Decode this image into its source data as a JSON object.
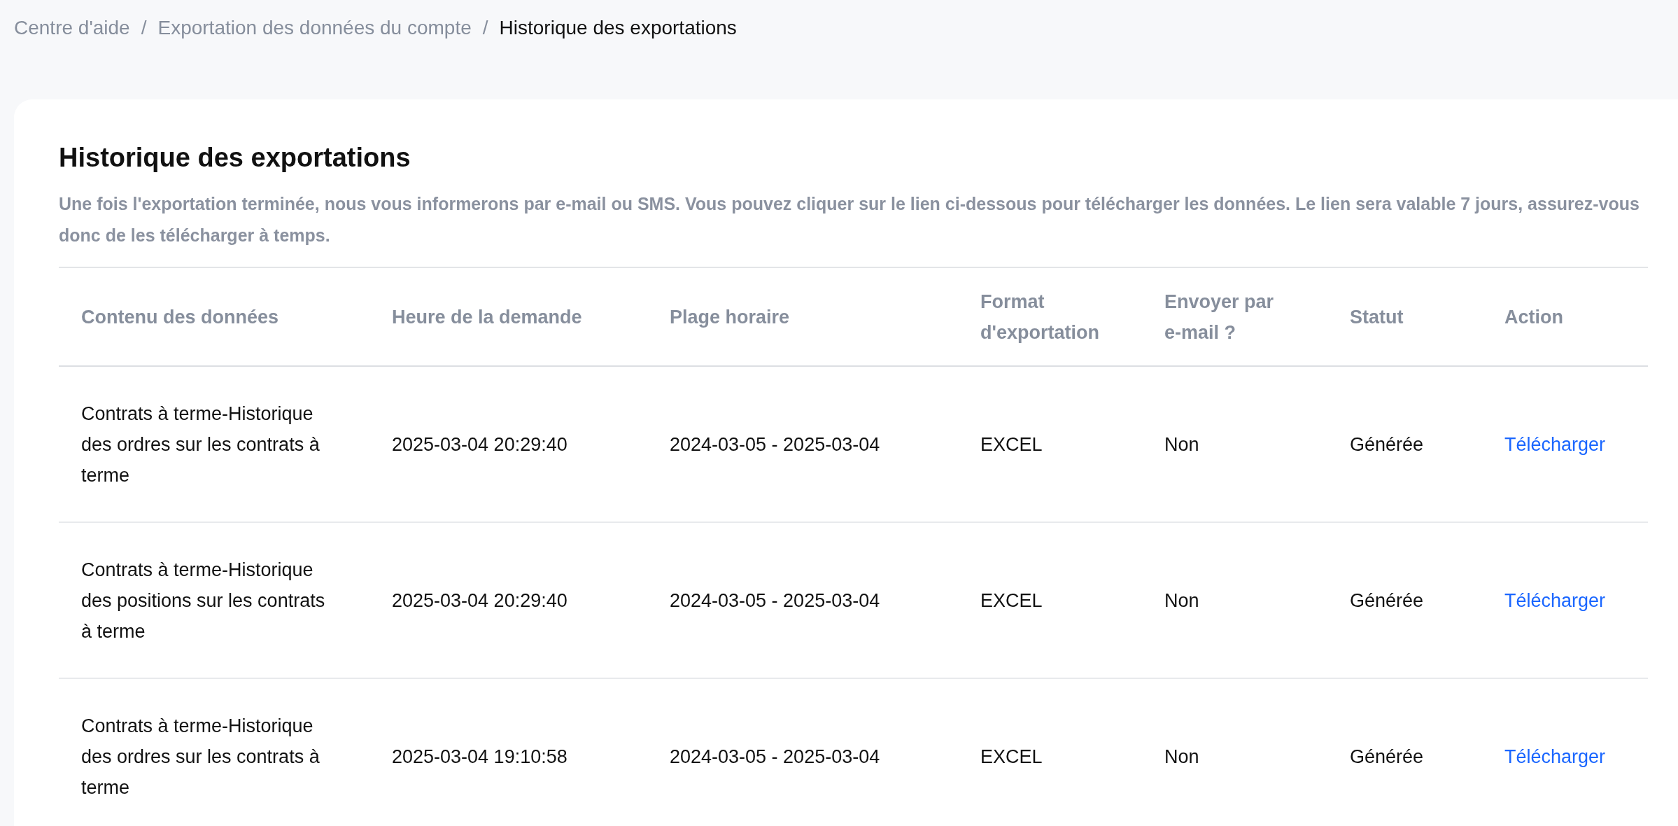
{
  "breadcrumb": [
    {
      "label": "Centre d'aide",
      "current": false
    },
    {
      "label": "Exportation des données du compte",
      "current": false
    },
    {
      "label": "Historique des exportations",
      "current": true
    }
  ],
  "separator": "/",
  "title": "Historique des exportations",
  "description": "Une fois l'exportation terminée, nous vous informerons par e-mail ou SMS. Vous pouvez cliquer sur le lien ci-dessous pour télécharger les données. Le lien sera valable 7 jours, assurez-vous donc de les télécharger à temps.",
  "table": {
    "columns": [
      "Contenu des données",
      "Heure de la demande",
      "Plage horaire",
      "Format d'exportation",
      "Envoyer par e-mail ?",
      "Statut",
      "Action"
    ],
    "rows": [
      {
        "content": "Contrats à terme-Historique des ordres sur les contrats à terme",
        "requested": "2025-03-04 20:29:40",
        "range": "2024-03-05 - 2025-03-04",
        "format": "EXCEL",
        "email": "Non",
        "status": "Générée",
        "action": "Télécharger"
      },
      {
        "content": "Contrats à terme-Historique des positions sur les contrats à terme",
        "requested": "2025-03-04 20:29:40",
        "range": "2024-03-05 - 2025-03-04",
        "format": "EXCEL",
        "email": "Non",
        "status": "Générée",
        "action": "Télécharger"
      },
      {
        "content": "Contrats à terme-Historique des ordres sur les contrats à terme",
        "requested": "2025-03-04 19:10:58",
        "range": "2024-03-05 - 2025-03-04",
        "format": "EXCEL",
        "email": "Non",
        "status": "Générée",
        "action": "Télécharger"
      }
    ]
  }
}
